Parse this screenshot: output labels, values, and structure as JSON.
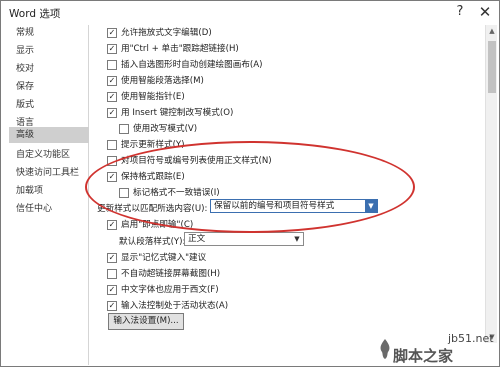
{
  "window": {
    "title": "Word 选项",
    "help_glyph": "?",
    "close_glyph": "✕"
  },
  "sidebar": {
    "items": [
      {
        "label": "常规"
      },
      {
        "label": "显示"
      },
      {
        "label": "校对"
      },
      {
        "label": "保存"
      },
      {
        "label": "版式"
      },
      {
        "label": "语言"
      },
      {
        "label": "高级",
        "selected": true
      },
      {
        "label": "自定义功能区"
      },
      {
        "label": "快速访问工具栏"
      },
      {
        "label": "加载项"
      },
      {
        "label": "信任中心"
      }
    ]
  },
  "options": {
    "o0": {
      "label": "允许拖放式文字编辑(D)",
      "checked": true
    },
    "o1": {
      "label": "用\"Ctrl + 单击\"跟踪超链接(H)",
      "checked": true
    },
    "o2": {
      "label": "插入自选图形时自动创建绘图画布(A)",
      "checked": false
    },
    "o3": {
      "label": "使用智能段落选择(M)",
      "checked": true
    },
    "o4": {
      "label": "使用智能指针(E)",
      "checked": true
    },
    "o5": {
      "label": "用 Insert 键控制改写模式(O)",
      "checked": true
    },
    "o6": {
      "label": "使用改写模式(V)",
      "checked": false
    },
    "o7": {
      "label": "提示更新样式(Y)",
      "checked": false
    },
    "o8": {
      "label": "对项目符号或编号列表使用正文样式(N)",
      "checked": false
    },
    "o9": {
      "label": "保持格式跟踪(E)",
      "checked": true
    },
    "o10": {
      "label": "标记格式不一致错误(I)",
      "checked": false
    },
    "o11": {
      "label": "启用\"即点即输\"(C)",
      "checked": true
    },
    "o12": {
      "label": "显示\"记忆式键入\"建议",
      "checked": true
    },
    "o13": {
      "label": "不自动超链接屏幕截图(H)",
      "checked": false
    },
    "o14": {
      "label": "中文字体也应用于西文(F)",
      "checked": true
    },
    "o15": {
      "label": "输入法控制处于活动状态(A)",
      "checked": true
    }
  },
  "update_style": {
    "label": "更新样式以匹配所选内容(U):",
    "value": "保留以前的编号和项目符号样式"
  },
  "default_para": {
    "label": "默认段落样式(Y):",
    "value": "正文"
  },
  "ime_button": {
    "label": "输入法设置(M)..."
  },
  "watermark": {
    "site": "jb51.net",
    "name": "脚本之家"
  }
}
